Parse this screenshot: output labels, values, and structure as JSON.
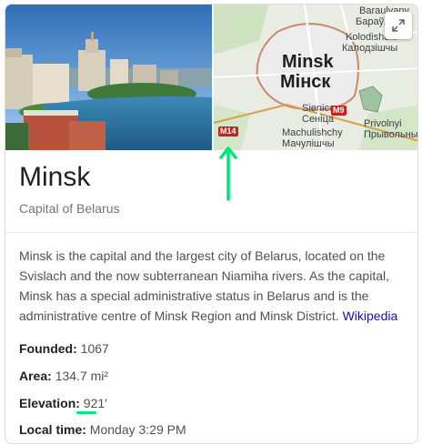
{
  "map": {
    "city_latin": "Minsk",
    "city_cyrillic": "Мінск",
    "labels": {
      "baraulyany_latin": "Baraulyany",
      "baraulyany_cyrillic": "Бараўляны",
      "kolodishchi_latin": "Kolodishchi",
      "kolodishchi_cyrillic": "Калодзішчы",
      "sienica_latin": "Sienica",
      "sienica_cyrillic": "Сеніца",
      "machulishchy_latin": "Machulishchy",
      "machulishchy_cyrillic": "Мачулішчы",
      "privolnyi_latin": "Privolnyi",
      "privolnyi_cyrillic": "Прывольны"
    },
    "roads": {
      "m9": "M9",
      "m14": "M14"
    }
  },
  "entity": {
    "title": "Minsk",
    "subtitle": "Capital of Belarus"
  },
  "description": {
    "text": "Minsk is the capital and the largest city of Belarus, located on the Svislach and the now subterranean Niamiha rivers. As the capital, Minsk has a special administrative status in Belarus and is the administrative centre of Minsk Region and Minsk District. ",
    "source_link": "Wikipedia"
  },
  "facts": {
    "founded": {
      "label": "Founded:",
      "value": "1067"
    },
    "area": {
      "label": "Area:",
      "value": "134.7 mi²"
    },
    "elevation": {
      "label": "Elevation:",
      "value": "921′"
    },
    "local_time": {
      "label": "Local time:",
      "value": "Monday 3:29 PM"
    }
  },
  "colors": {
    "annotation_green": "#00e676",
    "link_blue": "#1a0dab"
  }
}
